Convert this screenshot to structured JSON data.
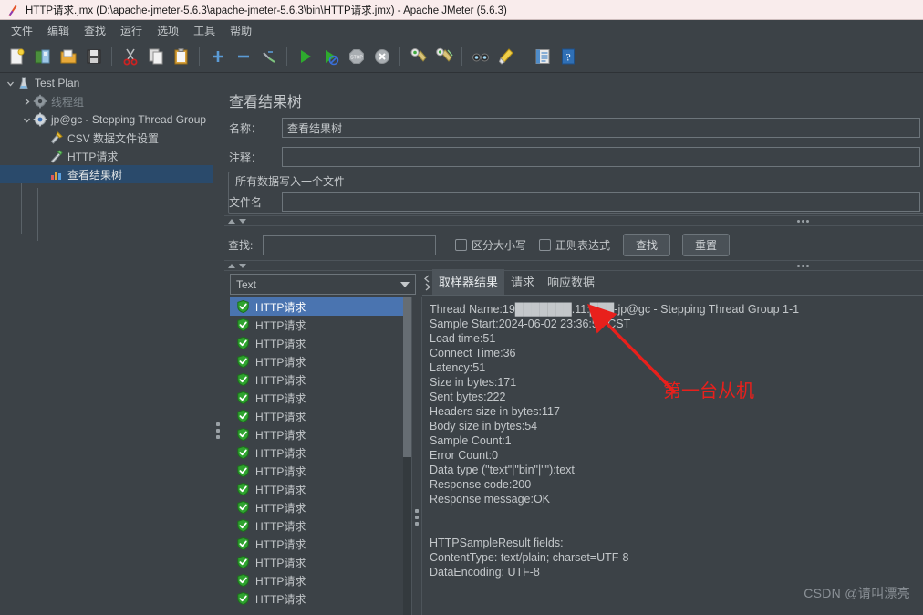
{
  "window": {
    "title": "HTTP请求.jmx (D:\\apache-jmeter-5.6.3\\apache-jmeter-5.6.3\\bin\\HTTP请求.jmx) - Apache JMeter (5.6.3)",
    "icon": "jmeter-feather-icon"
  },
  "menubar": {
    "items": [
      {
        "label": "文件",
        "name": "menu-file"
      },
      {
        "label": "编辑",
        "name": "menu-edit"
      },
      {
        "label": "查找",
        "name": "menu-search"
      },
      {
        "label": "运行",
        "name": "menu-run"
      },
      {
        "label": "选项",
        "name": "menu-options"
      },
      {
        "label": "工具",
        "name": "menu-tools"
      },
      {
        "label": "帮助",
        "name": "menu-help"
      }
    ]
  },
  "toolbar": {
    "buttons": [
      {
        "name": "new-icon",
        "title": "新建"
      },
      {
        "name": "templates-icon",
        "title": "模板"
      },
      {
        "name": "open-icon",
        "title": "打开"
      },
      {
        "name": "save-icon",
        "title": "保存"
      },
      {
        "name": "cut-icon",
        "title": "剪切"
      },
      {
        "name": "copy-icon",
        "title": "复制"
      },
      {
        "name": "paste-icon",
        "title": "粘贴"
      },
      {
        "name": "expand-all-icon",
        "title": "展开全部"
      },
      {
        "name": "collapse-all-icon",
        "title": "收起全部"
      },
      {
        "name": "toggle-icon",
        "title": "切换"
      },
      {
        "name": "start-icon",
        "title": "启动"
      },
      {
        "name": "start-no-pauses-icon",
        "title": "无停顿启动"
      },
      {
        "name": "stop-icon",
        "title": "停止"
      },
      {
        "name": "shutdown-icon",
        "title": "关闭"
      },
      {
        "name": "clear-icon",
        "title": "清除"
      },
      {
        "name": "clear-all-icon",
        "title": "清除全部"
      },
      {
        "name": "search-icon",
        "title": "查找"
      },
      {
        "name": "search-reset-icon",
        "title": "重置查找"
      },
      {
        "name": "function-helper-icon",
        "title": "函数助手对话框"
      },
      {
        "name": "help-icon",
        "title": "帮助"
      }
    ]
  },
  "tree": {
    "nodes": [
      {
        "label": "Test Plan",
        "icon": "test-plan-icon",
        "indent": 0,
        "twisty": "expanded",
        "selected": false,
        "disabled": false,
        "name": "tree-node-test-plan"
      },
      {
        "label": "线程组",
        "icon": "thread-group-icon",
        "indent": 1,
        "twisty": "collapsed",
        "selected": false,
        "disabled": true,
        "name": "tree-node-thread-group"
      },
      {
        "label": "jp@gc - Stepping Thread Group",
        "icon": "stepping-thread-group-icon",
        "indent": 1,
        "twisty": "expanded",
        "selected": false,
        "disabled": false,
        "name": "tree-node-stepping-thread-group"
      },
      {
        "label": "CSV 数据文件设置",
        "icon": "csv-data-set-icon",
        "indent": 2,
        "twisty": "none",
        "selected": false,
        "disabled": false,
        "name": "tree-node-csv-data-set"
      },
      {
        "label": "HTTP请求",
        "icon": "http-request-icon",
        "indent": 2,
        "twisty": "none",
        "selected": false,
        "disabled": false,
        "name": "tree-node-http-request"
      },
      {
        "label": "查看结果树",
        "icon": "view-results-tree-icon",
        "indent": 2,
        "twisty": "none",
        "selected": true,
        "disabled": false,
        "name": "tree-node-view-results-tree"
      }
    ]
  },
  "panel": {
    "title": "查看结果树",
    "name_label": "名称：",
    "name_value": "查看结果树",
    "comment_label": "注释：",
    "comment_value": "",
    "group_legend": "所有数据写入一个文件",
    "filename_label": "文件名",
    "filename_value": ""
  },
  "search": {
    "label": "查找:",
    "value": "",
    "case_sensitive_label": "区分大小写",
    "case_sensitive_checked": false,
    "regex_label": "正则表达式",
    "regex_checked": false,
    "find_button": "查找",
    "reset_button": "重置"
  },
  "results": {
    "renderer_selected": "Text",
    "items": [
      {
        "label": "HTTP请求",
        "status": "success",
        "selected": true
      },
      {
        "label": "HTTP请求",
        "status": "success",
        "selected": false
      },
      {
        "label": "HTTP请求",
        "status": "success",
        "selected": false
      },
      {
        "label": "HTTP请求",
        "status": "success",
        "selected": false
      },
      {
        "label": "HTTP请求",
        "status": "success",
        "selected": false
      },
      {
        "label": "HTTP请求",
        "status": "success",
        "selected": false
      },
      {
        "label": "HTTP请求",
        "status": "success",
        "selected": false
      },
      {
        "label": "HTTP请求",
        "status": "success",
        "selected": false
      },
      {
        "label": "HTTP请求",
        "status": "success",
        "selected": false
      },
      {
        "label": "HTTP请求",
        "status": "success",
        "selected": false
      },
      {
        "label": "HTTP请求",
        "status": "success",
        "selected": false
      },
      {
        "label": "HTTP请求",
        "status": "success",
        "selected": false
      },
      {
        "label": "HTTP请求",
        "status": "success",
        "selected": false
      },
      {
        "label": "HTTP请求",
        "status": "success",
        "selected": false
      },
      {
        "label": "HTTP请求",
        "status": "success",
        "selected": false
      },
      {
        "label": "HTTP请求",
        "status": "success",
        "selected": false
      },
      {
        "label": "HTTP请求",
        "status": "success",
        "selected": false
      }
    ],
    "tabs": [
      {
        "label": "取样器结果",
        "active": true,
        "name": "tab-sampler-result"
      },
      {
        "label": "请求",
        "active": false,
        "name": "tab-request"
      },
      {
        "label": "响应数据",
        "active": false,
        "name": "tab-response-data"
      }
    ],
    "detail_lines": [
      "Thread Name:19███████.11:███-jp@gc - Stepping Thread Group 1-1",
      "Sample Start:2024-06-02 23:36:59 CST",
      "Load time:51",
      "Connect Time:36",
      "Latency:51",
      "Size in bytes:171",
      "Sent bytes:222",
      "Headers size in bytes:117",
      "Body size in bytes:54",
      "Sample Count:1",
      "Error Count:0",
      "Data type (\"text\"|\"bin\"|\"\"):text",
      "Response code:200",
      "Response message:OK",
      "",
      "",
      "HTTPSampleResult fields:",
      "ContentType: text/plain; charset=UTF-8",
      "DataEncoding: UTF-8"
    ]
  },
  "annotation": {
    "text": "第一台从机",
    "color": "#e8201c"
  },
  "watermark": {
    "text": "CSDN @请叫漂亮"
  },
  "colors": {
    "background": "#3c4247",
    "titlebar": "#f9ecec",
    "selection": "#4a74b0",
    "tree_selection": "#2a4a6b",
    "text": "#c3c7ca",
    "accent_red": "#e8201c",
    "success_green": "#2fa32f"
  }
}
